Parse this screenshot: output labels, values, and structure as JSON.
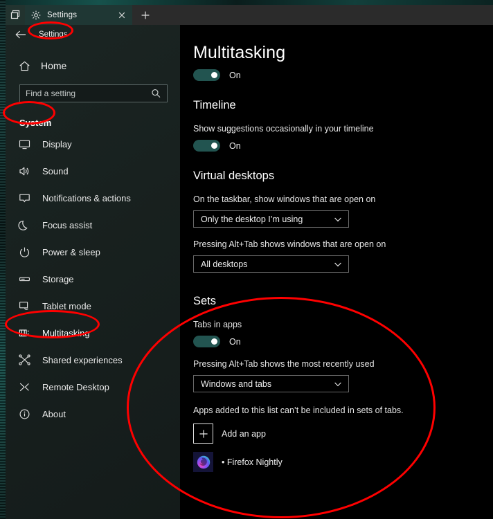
{
  "window": {
    "tab": {
      "system_menu_icon": "tab-overview-icon",
      "app_icon": "gear-icon",
      "title": "Settings",
      "close_icon": "close-icon",
      "new_tab_icon": "plus-icon"
    }
  },
  "sidebar": {
    "back_icon": "arrow-left-icon",
    "back_label": "Settings",
    "home_icon": "home-icon",
    "home_label": "Home",
    "search": {
      "placeholder": "Find a setting",
      "value": "",
      "icon": "search-icon"
    },
    "section_title": "System",
    "items": [
      {
        "icon": "monitor-icon",
        "label": "Display"
      },
      {
        "icon": "speaker-icon",
        "label": "Sound"
      },
      {
        "icon": "chat-bubble-icon",
        "label": "Notifications & actions"
      },
      {
        "icon": "moon-icon",
        "label": "Focus assist"
      },
      {
        "icon": "power-icon",
        "label": "Power & sleep"
      },
      {
        "icon": "drive-icon",
        "label": "Storage"
      },
      {
        "icon": "tablet-icon",
        "label": "Tablet mode"
      },
      {
        "icon": "multitasking-icon",
        "label": "Multitasking"
      },
      {
        "icon": "share-nodes-icon",
        "label": "Shared experiences"
      },
      {
        "icon": "remote-desktop-icon",
        "label": "Remote Desktop"
      },
      {
        "icon": "info-circle-icon",
        "label": "About"
      }
    ]
  },
  "main": {
    "page_title": "Multitasking",
    "page_toggle": {
      "state": "On",
      "on": true
    },
    "timeline": {
      "heading": "Timeline",
      "suggestion_label": "Show suggestions occasionally in your timeline",
      "suggestion_toggle": {
        "state": "On",
        "on": true
      }
    },
    "virtual_desktops": {
      "heading": "Virtual desktops",
      "taskbar_label": "On the taskbar, show windows that are open on",
      "taskbar_value": "Only the desktop I’m using",
      "alttab_label": "Pressing Alt+Tab shows windows that are open on",
      "alttab_value": "All desktops"
    },
    "sets": {
      "heading": "Sets",
      "tabs_in_apps_label": "Tabs in apps",
      "tabs_in_apps_toggle": {
        "state": "On",
        "on": true
      },
      "alttab_label": "Pressing Alt+Tab shows the most recently used",
      "alttab_value": "Windows and tabs",
      "applist_note": "Apps added to this list can’t be included in sets of tabs.",
      "add_app_label": "Add an app",
      "add_app_icon": "plus-icon",
      "apps": [
        {
          "icon": "firefox-nightly-icon",
          "label": "• Firefox Nightly"
        }
      ]
    }
  },
  "annotations": {
    "color": "#ff0000",
    "shapes": [
      {
        "name": "settings-tab-circle",
        "target": "sidebar back label 'Settings'"
      },
      {
        "name": "system-circle",
        "target": "sidebar section title 'System'"
      },
      {
        "name": "multitasking-circle",
        "target": "sidebar item 'Multitasking'"
      },
      {
        "name": "sets-circle",
        "target": "main 'Sets' section"
      }
    ]
  }
}
